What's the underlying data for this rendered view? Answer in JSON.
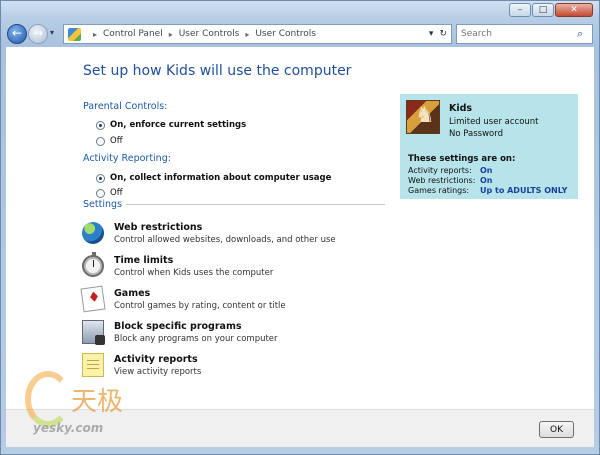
{
  "window": {
    "controls": {
      "minimize": "–",
      "maximize": "□",
      "close": "✕"
    }
  },
  "nav": {
    "back": "←",
    "forward": "→",
    "dropdown": "▾"
  },
  "address": {
    "crumbs": [
      "Control Panel",
      "User Controls",
      "User Controls"
    ],
    "separator": "▸",
    "dropdown": "▾",
    "refresh": "↻"
  },
  "search": {
    "placeholder": "Search"
  },
  "page": {
    "title": "Set up how Kids will use the computer",
    "parental_controls_label": "Parental Controls:",
    "parental_on": "On, enforce current settings",
    "parental_off": "Off",
    "activity_label": "Activity Reporting:",
    "activity_on": "On, collect information about computer usage",
    "activity_off": "Off",
    "settings_label": "Settings",
    "settings": [
      {
        "icon": "globe-icon",
        "name": "Web restrictions",
        "desc": "Control allowed websites, downloads, and other use"
      },
      {
        "icon": "stopwatch-icon",
        "name": "Time limits",
        "desc": "Control when Kids uses the computer"
      },
      {
        "icon": "playing-cards-icon",
        "name": "Games",
        "desc": "Control games by rating, content or title"
      },
      {
        "icon": "blocked-program-icon",
        "name": "Block specific programs",
        "desc": "Block any programs on your computer"
      },
      {
        "icon": "notepad-icon",
        "name": "Activity reports",
        "desc": "View activity reports"
      }
    ]
  },
  "panel": {
    "user_name": "Kids",
    "account_type": "Limited user account",
    "password": "No Password",
    "heading": "These settings are on:",
    "rows": [
      {
        "key": "Activity reports:",
        "value": "On"
      },
      {
        "key": "Web restrictions:",
        "value": "On"
      },
      {
        "key": "Games ratings:",
        "value": "Up to ADULTS ONLY"
      }
    ]
  },
  "footer": {
    "ok": "OK"
  },
  "watermark": {
    "cn": "天极",
    "url": "yesky.com"
  },
  "colors": {
    "accent": "#1e4f9c",
    "panel_bg": "#b7e3ea",
    "value_blue": "#1d3f9a"
  }
}
